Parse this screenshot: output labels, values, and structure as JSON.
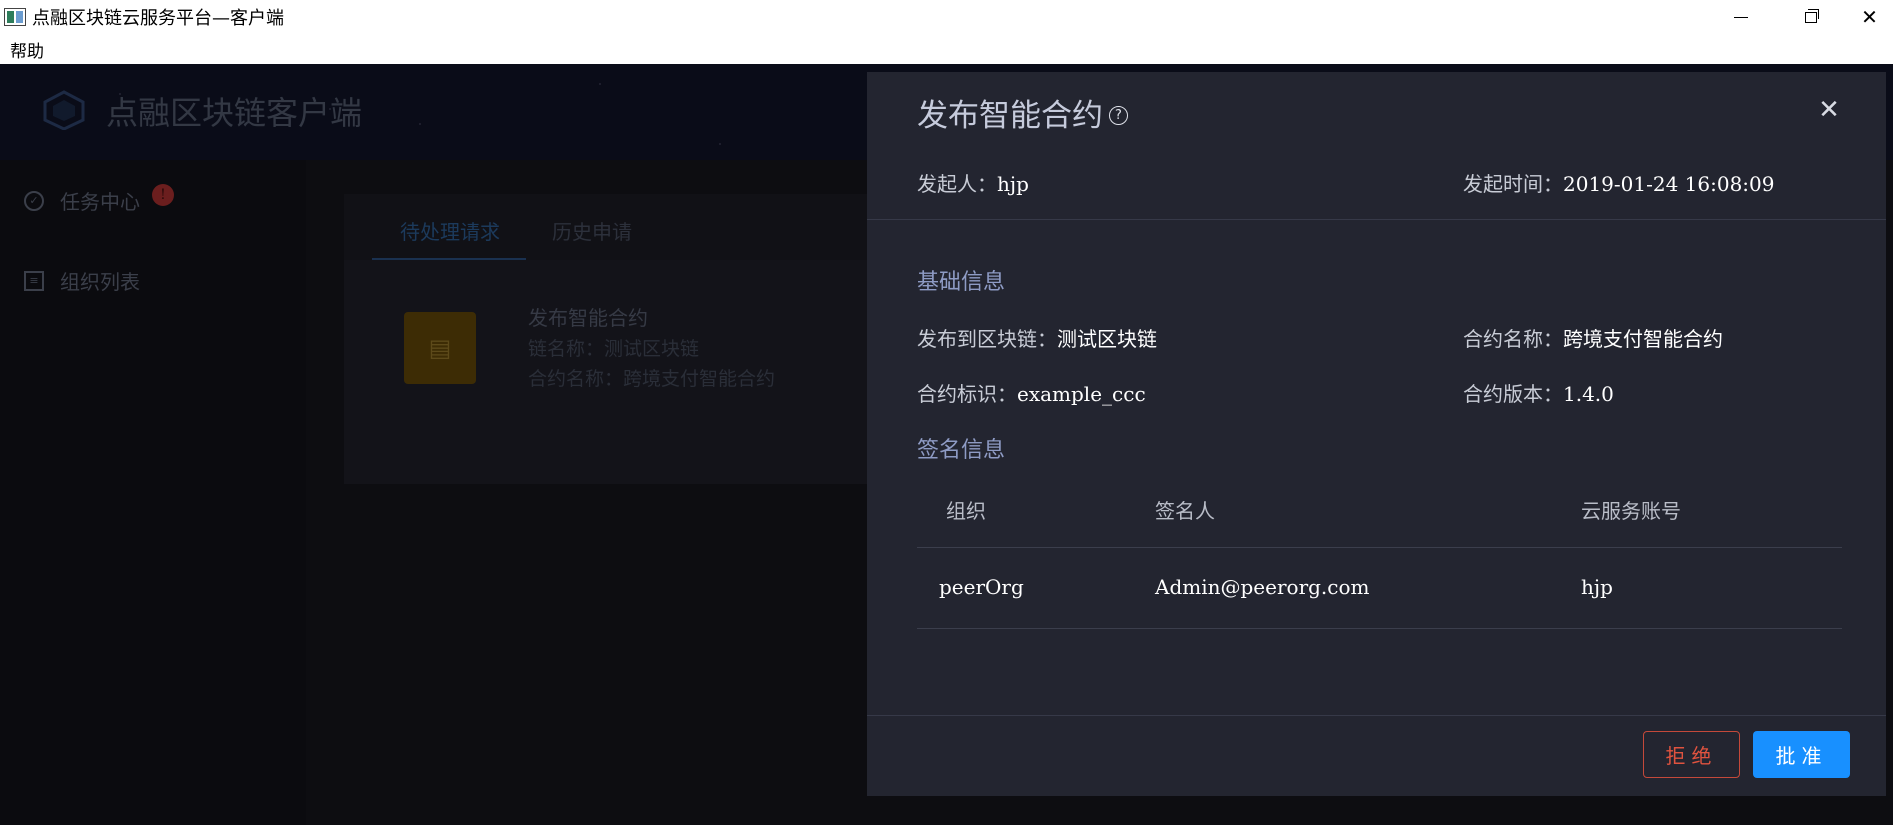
{
  "window": {
    "title": "点融区块链云服务平台—客户端",
    "controls": {
      "minimize": "minimize",
      "maximize": "restore",
      "close": "✕"
    }
  },
  "menu": {
    "items": [
      "帮助"
    ]
  },
  "app": {
    "brand_title": "点融区块链客户端",
    "sidebar": [
      {
        "label": "任务中心",
        "icon": "check-circle-icon",
        "badge": "!"
      },
      {
        "label": "组织列表",
        "icon": "list-icon"
      }
    ],
    "tabs": [
      "待处理请求",
      "历史申请"
    ],
    "request_card": {
      "title": "发布智能合约",
      "chain_line": "链名称：测试区块链",
      "contract_line": "合约名称：跨境支付智能合约"
    }
  },
  "drawer": {
    "title": "发布智能合约",
    "initiator_label": "发起人：",
    "initiator_value": "hjp",
    "time_label": "发起时间：",
    "time_value": "2019-01-24 16:08:09",
    "basic_title": "基础信息",
    "fields": {
      "chain_label": "发布到区块链：",
      "chain_value": "测试区块链",
      "name_label": "合约名称：",
      "name_value": "跨境支付智能合约",
      "id_label": "合约标识：",
      "id_value": "example_ccc",
      "version_label": "合约版本：",
      "version_value": "1.4.0"
    },
    "signature_title": "签名信息",
    "table": {
      "headers": [
        "组织",
        "签名人",
        "云服务账号"
      ],
      "rows": [
        [
          "peerOrg",
          "Admin@peerorg.com",
          "hjp"
        ]
      ]
    },
    "buttons": {
      "reject": "拒绝",
      "approve": "批准"
    },
    "colors": {
      "primary": "#1890ff",
      "danger": "#e0533f",
      "section": "#8e9bc4"
    }
  }
}
